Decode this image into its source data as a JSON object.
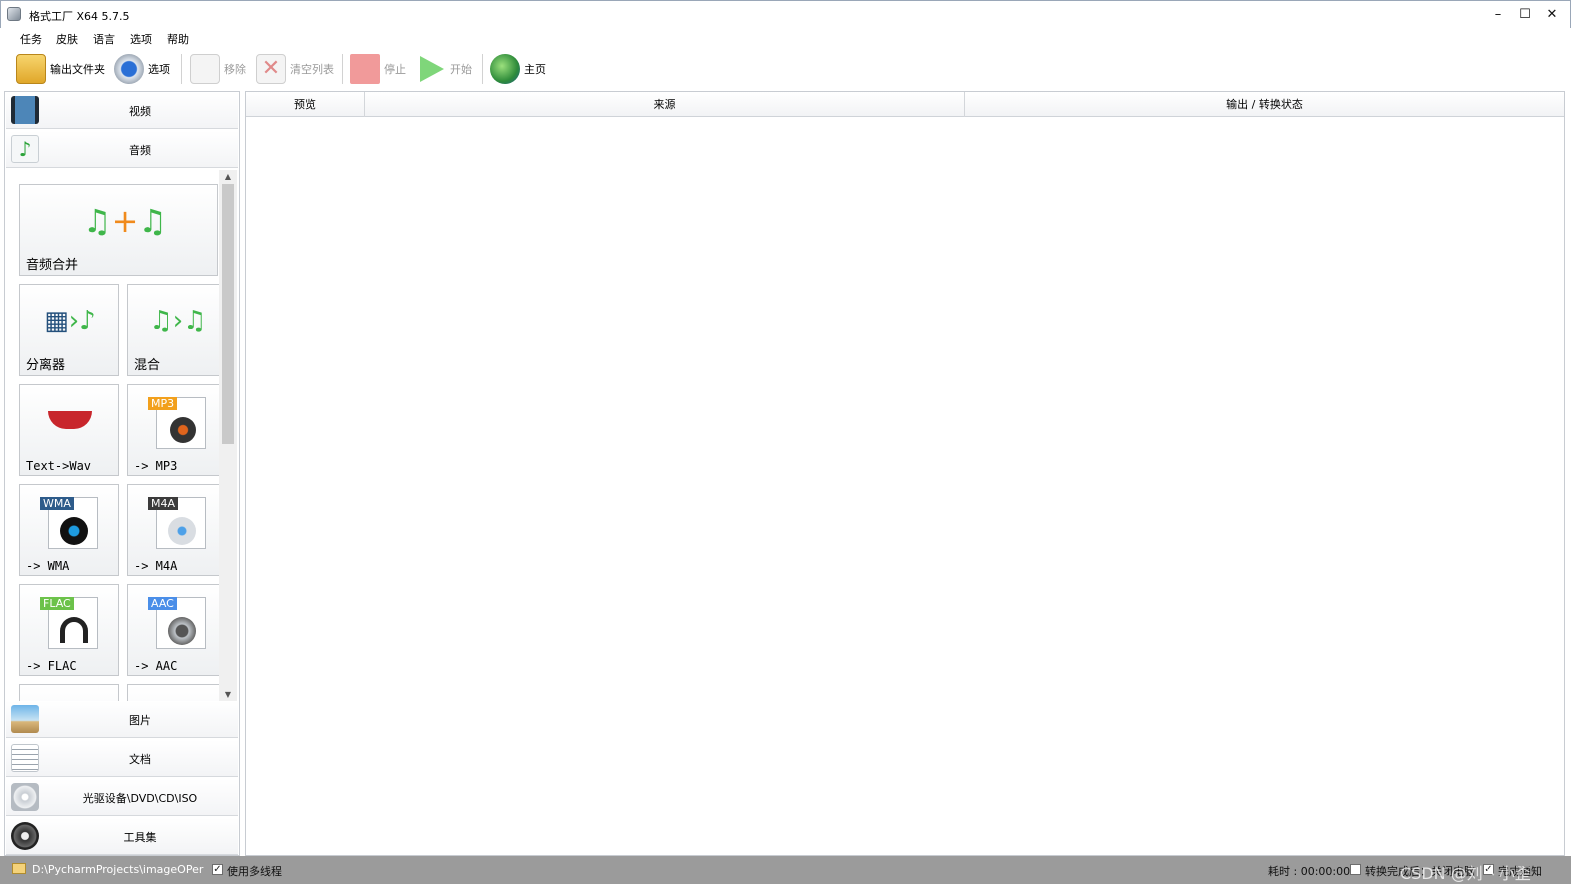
{
  "window": {
    "title": "格式工厂 X64 5.7.5"
  },
  "menu": [
    "任务",
    "皮肤",
    "语言",
    "选项",
    "帮助"
  ],
  "toolbar": {
    "output_folder": "输出文件夹",
    "options": "选项",
    "remove": "移除",
    "clear_list": "清空列表",
    "stop": "停止",
    "start": "开始",
    "home": "主页"
  },
  "categories": {
    "video": "视频",
    "audio": "音频",
    "image": "图片",
    "document": "文档",
    "optical": "光驱设备\\DVD\\CD\\ISO",
    "tools": "工具集"
  },
  "audio_tiles": {
    "merge": "音频合并",
    "splitter": "分离器",
    "mix": "混合",
    "text_wav": "Text->Wav",
    "mp3": "-> MP3",
    "wma": "-> WMA",
    "m4a": "-> M4A",
    "flac": "-> FLAC",
    "aac": "-> AAC",
    "mp3_badge": "MP3",
    "wma_badge": "WMA",
    "m4a_badge": "M4A",
    "flac_badge": "FLAC",
    "aac_badge": "AAC"
  },
  "columns": {
    "preview": "预览",
    "source": "来源",
    "output": "输出 / 转换状态"
  },
  "status": {
    "path": "D:\\PycharmProjects\\imageOPer",
    "multithread": "使用多线程",
    "elapsed": "耗时 : 00:00:00",
    "after_done": "转换完成后：关闭电脑",
    "notify": "完成通知",
    "watermark": "CSDN @刘丶小歪"
  },
  "colors": {
    "status_bar": "#9b9b9b",
    "stop_icon": "#f19a9a",
    "start_icon": "#7fd67a"
  }
}
